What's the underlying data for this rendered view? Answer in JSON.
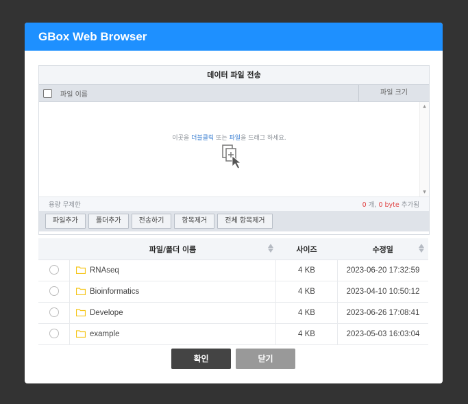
{
  "dialog": {
    "title": "GBox Web Browser"
  },
  "transfer": {
    "title": "데이터 파일 전송",
    "columns": {
      "name": "파일 이름",
      "size": "파일 크기"
    },
    "dropzone_hint_prefix": "이곳을 ",
    "dropzone_hint_highlight": "더블클릭",
    "dropzone_hint_mid": " 또는 ",
    "dropzone_hint_highlight2": "파일",
    "dropzone_hint_suffix": "을 드래그 하세요.",
    "capacity": "용량 무제한",
    "added_count": "0",
    "added_count_unit": " 개, ",
    "added_bytes": "0 byte",
    "added_suffix": " 추가됨",
    "buttons": {
      "add_file": "파일추가",
      "add_folder": "폴더추가",
      "send": "전송하기",
      "remove_item": "항목제거",
      "remove_all": "전체 항목제거"
    }
  },
  "file_list": {
    "headers": {
      "name": "파일/폴더 이름",
      "size": "사이즈",
      "modified": "수정일"
    },
    "rows": [
      {
        "name": "RNAseq",
        "size": "4 KB",
        "modified": "2023-06-20 17:32:59"
      },
      {
        "name": "Bioinformatics",
        "size": "4 KB",
        "modified": "2023-04-10 10:50:12"
      },
      {
        "name": "Develope",
        "size": "4 KB",
        "modified": "2023-06-26 17:08:41"
      },
      {
        "name": "example",
        "size": "4 KB",
        "modified": "2023-05-03 16:03:04"
      }
    ]
  },
  "actions": {
    "confirm": "확인",
    "close": "닫기"
  },
  "colors": {
    "header": "#1e90ff",
    "confirm": "#444444",
    "close": "#999999",
    "folder": "#f5c518"
  },
  "icons": [
    "folder-icon",
    "upload-files-icon",
    "sort-icon",
    "checkbox-icon",
    "radio-icon"
  ]
}
